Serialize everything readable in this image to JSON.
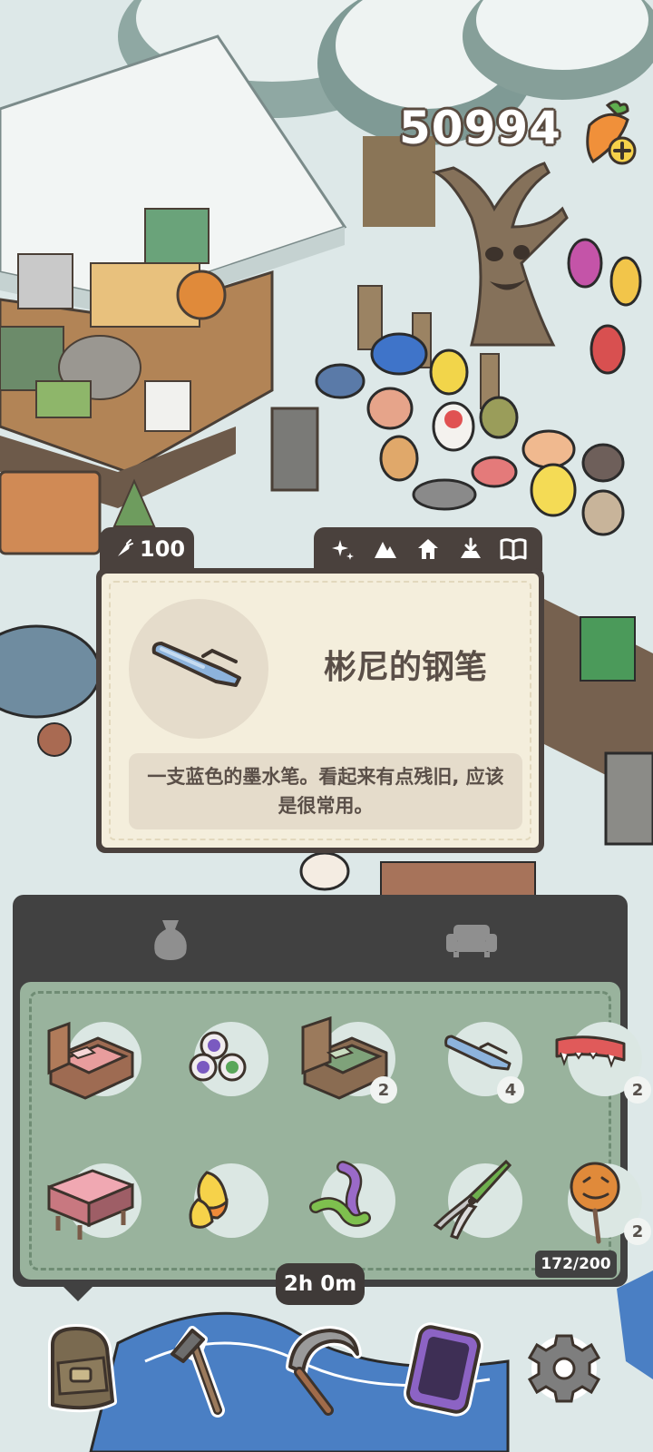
{
  "hud": {
    "carrots": "50994"
  },
  "item_detail": {
    "price": "100",
    "title": "彬尼的钢笔",
    "description": "一支蓝色的墨水笔。看起来有点残旧, 应该是很常用。",
    "tool_tabs": [
      "sparkle-icon",
      "mountain-icon",
      "home-icon",
      "import-icon",
      "book-icon"
    ]
  },
  "inventory": {
    "tabs": [
      "bag-icon",
      "sofa-icon"
    ],
    "capacity": "172/200",
    "items": [
      {
        "name": "pink-bed",
        "count": ""
      },
      {
        "name": "eyeballs",
        "count": ""
      },
      {
        "name": "green-bed",
        "count": "2"
      },
      {
        "name": "blue-pen",
        "count": "4"
      },
      {
        "name": "vampire-teeth",
        "count": "2"
      },
      {
        "name": "pink-table",
        "count": ""
      },
      {
        "name": "candy-corn",
        "count": ""
      },
      {
        "name": "gummy-worm",
        "count": ""
      },
      {
        "name": "pruning-shears",
        "count": ""
      },
      {
        "name": "pumpkin-lollipop",
        "count": "2"
      }
    ]
  },
  "bottom_bar": {
    "timer": "2h 0m",
    "tools": [
      "backpack-icon",
      "axe-icon",
      "sickle-icon",
      "phone-icon",
      "settings-icon"
    ]
  },
  "colors": {
    "panel_dark": "#414141",
    "grid_green": "#99b39d",
    "card_cream": "#f4eedc",
    "text_brown": "#5a4f48"
  }
}
